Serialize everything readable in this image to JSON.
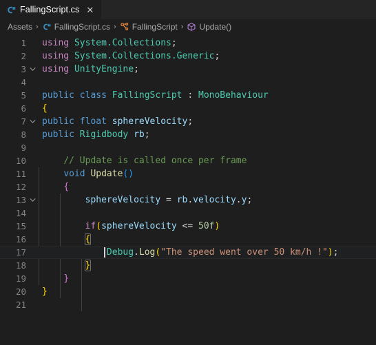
{
  "window": {
    "background": "#1e1e1e",
    "tabbar_background": "#252526"
  },
  "tab_bar": {
    "tabs": [
      {
        "label": "FallingScript.cs",
        "icon": "csharp-file-icon",
        "active": true,
        "close_label": "✕"
      }
    ]
  },
  "breadcrumb": {
    "separator": "›",
    "items": [
      {
        "label": "Assets",
        "icon": null
      },
      {
        "label": "FallingScript.cs",
        "icon": "csharp-file-icon"
      },
      {
        "label": "FallingScript",
        "icon": "class-symbol-icon"
      },
      {
        "label": "Update()",
        "icon": "method-symbol-icon"
      }
    ]
  },
  "editor": {
    "language": "csharp",
    "current_line": 17,
    "cursor": {
      "line": 17,
      "column": 9
    },
    "total_lines": 21,
    "line_numbers": [
      "1",
      "2",
      "3",
      "4",
      "5",
      "6",
      "7",
      "8",
      "9",
      "10",
      "11",
      "12",
      "13",
      "14",
      "15",
      "16",
      "17",
      "18",
      "19",
      "20",
      "21"
    ],
    "fold_markers": [
      1,
      5,
      11,
      15
    ],
    "colors": {
      "keyword": "#569cd6",
      "keyword_control": "#c586c0",
      "type": "#4ec9b0",
      "function": "#dcdcaa",
      "variable": "#9cdcfe",
      "string": "#ce9178",
      "number": "#b5cea8",
      "comment": "#6a9955",
      "plain": "#d4d4d4",
      "line_number": "#858585",
      "current_line_bg": "#1f2021",
      "cursor": "#d7d7d7"
    },
    "lines": [
      {
        "n": "1",
        "text": "using System.Collections;"
      },
      {
        "n": "2",
        "text": "using System.Collections.Generic;"
      },
      {
        "n": "3",
        "text": "using UnityEngine;"
      },
      {
        "n": "4",
        "text": ""
      },
      {
        "n": "5",
        "text": "public class FallingScript : MonoBehaviour"
      },
      {
        "n": "6",
        "text": "{"
      },
      {
        "n": "7",
        "text": "public float sphereVelocity;"
      },
      {
        "n": "8",
        "text": "public Rigidbody rb;"
      },
      {
        "n": "9",
        "text": ""
      },
      {
        "n": "10",
        "text": "    // Update is called once per frame"
      },
      {
        "n": "11",
        "text": "    void Update()"
      },
      {
        "n": "12",
        "text": "    {"
      },
      {
        "n": "13",
        "text": "        sphereVelocity = rb.velocity.y;"
      },
      {
        "n": "14",
        "text": ""
      },
      {
        "n": "15",
        "text": "        if(sphereVelocity <= 50f)"
      },
      {
        "n": "16",
        "text": "        {"
      },
      {
        "n": "17",
        "text": "            Debug.Log(\"The speed went over 50 km/h !\");"
      },
      {
        "n": "18",
        "text": "        }"
      },
      {
        "n": "19",
        "text": "    }"
      },
      {
        "n": "20",
        "text": "}"
      },
      {
        "n": "21",
        "text": ""
      }
    ],
    "tokens": {
      "l1": {
        "kw": "using",
        "ns": "System.Collections",
        "semi": ";"
      },
      "l2": {
        "kw": "using",
        "ns": "System.Collections.Generic",
        "semi": ";"
      },
      "l3": {
        "kw": "using",
        "ns": "UnityEngine",
        "semi": ";"
      },
      "l5": {
        "k1": "public",
        "k2": "class",
        "name": "FallingScript",
        "colon": ":",
        "base": "MonoBehaviour"
      },
      "l6": {
        "brace": "{"
      },
      "l7": {
        "k1": "public",
        "k2": "float",
        "name": "sphereVelocity",
        "semi": ";"
      },
      "l8": {
        "k1": "public",
        "type": "Rigidbody",
        "name": "rb",
        "semi": ";"
      },
      "l10": {
        "comment": "// Update is called once per frame"
      },
      "l11": {
        "kw": "void",
        "name": "Update",
        "parens": "()"
      },
      "l12": {
        "brace": "{"
      },
      "l13": {
        "lhs": "sphereVelocity",
        "eq": "=",
        "obj": "rb",
        "dot1": ".",
        "prop": "velocity",
        "dot2": ".",
        "axis": "y",
        "semi": ";"
      },
      "l15": {
        "kw": "if",
        "open": "(",
        "var": "sphereVelocity",
        "op": "<=",
        "num": "50f",
        "close": ")"
      },
      "l16": {
        "brace": "{"
      },
      "l17": {
        "type": "Debug",
        "dot": ".",
        "fn": "Log",
        "open": "(",
        "str": "\"The speed went over 50 km/h !\"",
        "close": ")",
        "semi": ";"
      },
      "l18": {
        "brace": "}"
      },
      "l19": {
        "brace": "}"
      },
      "l20": {
        "brace": "}"
      }
    }
  }
}
